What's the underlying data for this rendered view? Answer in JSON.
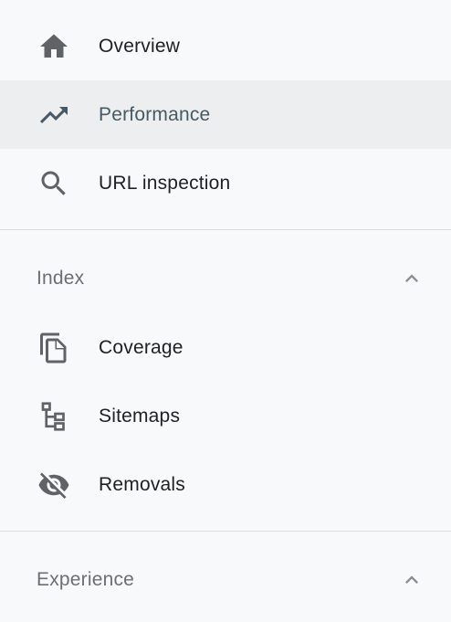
{
  "nav": {
    "top_items": [
      {
        "label": "Overview",
        "icon": "home-icon",
        "active": false
      },
      {
        "label": "Performance",
        "icon": "trending-up-icon",
        "active": true
      },
      {
        "label": "URL inspection",
        "icon": "search-icon",
        "active": false
      }
    ],
    "sections": [
      {
        "title": "Index",
        "expanded": true,
        "items": [
          {
            "label": "Coverage",
            "icon": "file-copy-icon"
          },
          {
            "label": "Sitemaps",
            "icon": "sitemap-icon"
          },
          {
            "label": "Removals",
            "icon": "visibility-off-icon"
          }
        ]
      },
      {
        "title": "Experience",
        "expanded": true
      }
    ]
  },
  "colors": {
    "background": "#f8f9fa",
    "active_background": "#eceeef",
    "active_text": "#455a64",
    "icon_gray": "#5f6368",
    "divider": "#dadce0",
    "section_title": "#6b6f73"
  }
}
